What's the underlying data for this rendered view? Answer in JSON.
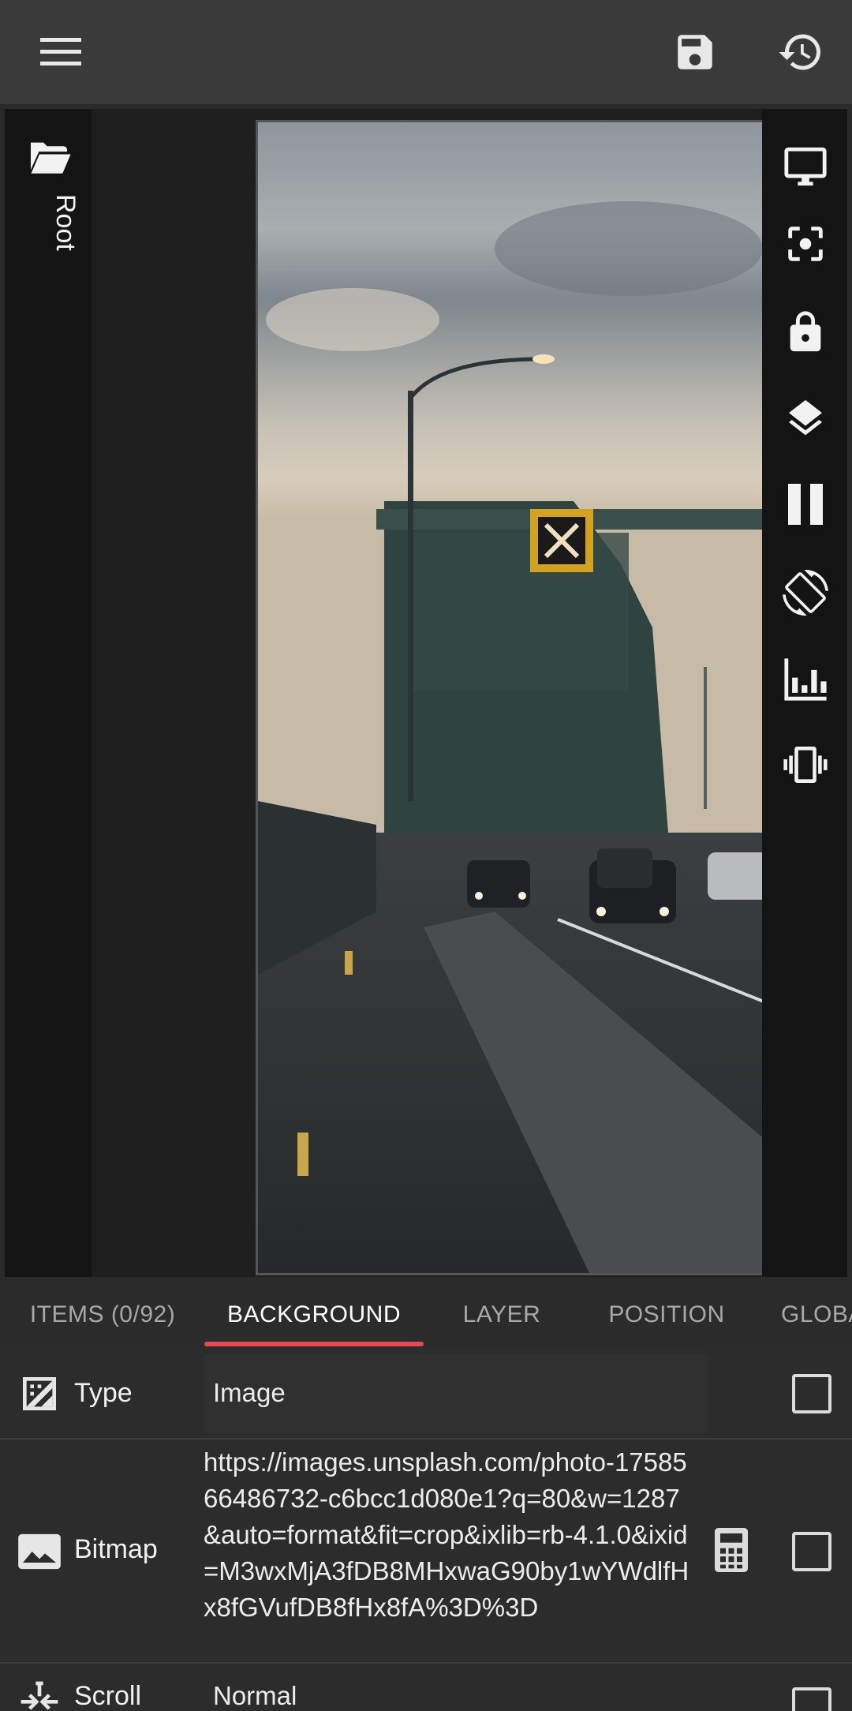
{
  "appbar": {
    "icons": [
      "menu-icon",
      "save-icon",
      "history-icon"
    ]
  },
  "left_rail": {
    "root_label": "Root",
    "icon": "folder-open-icon"
  },
  "right_rail": {
    "icons": [
      "monitor-icon",
      "focus-icon",
      "lock-icon",
      "layers-icon",
      "pause-icon",
      "screen-rotation-icon",
      "equalizer-icon",
      "vibrate-icon"
    ]
  },
  "tabs": [
    {
      "label": "ITEMS (0/92)",
      "active": false
    },
    {
      "label": "BACKGROUND",
      "active": true
    },
    {
      "label": "LAYER",
      "active": false
    },
    {
      "label": "POSITION",
      "active": false
    },
    {
      "label": "GLOBA",
      "active": false
    }
  ],
  "properties": [
    {
      "label": "Type",
      "value": "Image",
      "icon": "gradient-icon",
      "checked": false
    },
    {
      "label": "Bitmap",
      "value": "https://images.unsplash.com/photo-1758566486732-c6bcc1d080e1?q=80&w=1287&auto=format&fit=crop&ixlib=rb-4.1.0&ixid=M3wxMjA3fDB8MHxwaG90by1wYWdlfHx8fGVufDB8fHx8fA%3D%3D",
      "icon": "image-icon",
      "checked": false
    },
    {
      "label": "Scroll",
      "value": "Normal",
      "icon": "scroll-icon",
      "checked": false
    }
  ],
  "colors": {
    "accent": "#e24a5a",
    "appbar": "#3a3a3a",
    "rail": "#141414"
  }
}
